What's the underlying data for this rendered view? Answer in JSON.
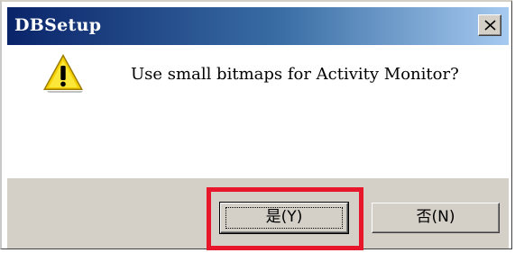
{
  "dialog": {
    "title": "DBSetup",
    "close_icon": "close-x-icon",
    "message": "Use small bitmaps for Activity Monitor?",
    "message_icon": "warning-icon",
    "buttons": {
      "yes_label": "是(Y)",
      "no_label": "否(N)"
    },
    "highlight_color": "#e8162b",
    "titlebar_colors": [
      "#0a246a",
      "#a6caf0"
    ]
  }
}
